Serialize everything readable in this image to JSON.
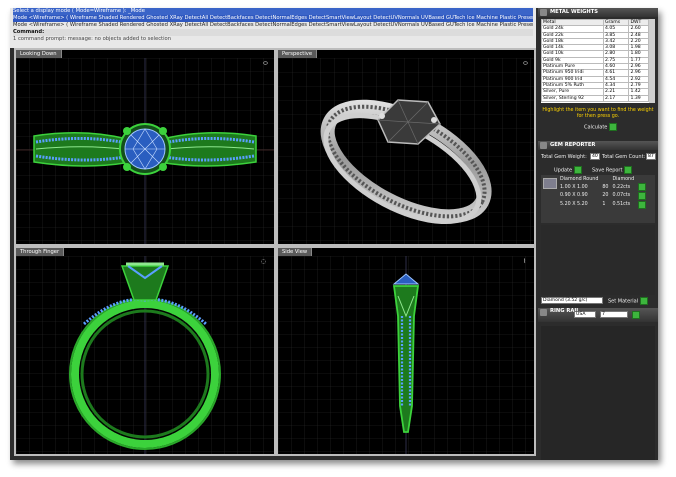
{
  "command": {
    "line1": "Select a display mode ( Mode=Wireframe ): _Mode",
    "line2": "Mode <Wireframe> ( Wireframe  Shaded  Rendered  Ghosted  XRay  DetectAll  DetectBackfaces  DetectNormalEdges  DetectSmartViewLayout  DetectUVNormals  UVBased  GUTech  Ice  Machine  Plastic  Presentation )",
    "line3": "Mode <Wireframe> ( Wireframe  Shaded  Rendered  Ghosted  XRay  DetectAll  DetectBackfaces  DetectNormalEdges  DetectSmartViewLayout  DetectUVNormals  UVBased  GUTech  Ice  Machine  Plastic  Presentation )",
    "prompt": "Command:",
    "history": "1 command prompt: message: no objects added to selection"
  },
  "viewports": {
    "top_left": "Looking Down",
    "top_right": "Perspective",
    "bottom_left": "Through Finger",
    "bottom_right": "Side View"
  },
  "metal_weights": {
    "title": "METAL WEIGHTS",
    "columns": [
      "Metal",
      "Grams",
      "DWT"
    ],
    "rows": [
      [
        "Gold 24k",
        "4.05",
        "2.60"
      ],
      [
        "Gold 22k",
        "3.85",
        "2.48"
      ],
      [
        "Gold 18k",
        "3.42",
        "2.20"
      ],
      [
        "Gold 14k",
        "3.08",
        "1.98"
      ],
      [
        "Gold 10k",
        "2.80",
        "1.80"
      ],
      [
        "Gold 9k",
        "2.75",
        "1.77"
      ],
      [
        "Platinum Pure",
        "4.60",
        "2.96"
      ],
      [
        "Platinum 950 Iridi",
        "4.61",
        "2.96"
      ],
      [
        "Platinum 900 Irid",
        "4.54",
        "2.92"
      ],
      [
        "Platinum 5% Ruth",
        "4.34",
        "2.79"
      ],
      [
        "Silver, Pure",
        "2.21",
        "1.42"
      ],
      [
        "Silver, Sterling 92",
        "2.17",
        "1.39"
      ]
    ],
    "help_text": "Highlight the item you want to find the weight for then press go.",
    "calculate_label": "Calculate"
  },
  "gem_reporter": {
    "title": "GEM REPORTER",
    "total_gem_weight_label": "Total Gem Weight:",
    "total_gem_weight": "40",
    "total_gem_count_label": "Total Gem Count:",
    "total_gem_count": "87",
    "update_label": "Update",
    "save_report_label": "Save Report",
    "header_shape": "Diamond Round",
    "header_material": "Diamond",
    "gems": [
      {
        "size": "1.00 X 1.00",
        "count": "80",
        "weight": "0.22cts"
      },
      {
        "size": "0.90 X 0.90",
        "count": "20",
        "weight": "0.07cts"
      },
      {
        "size": "5.20 X 5.20",
        "count": "1",
        "weight": "0.51cts"
      }
    ],
    "material_select": "Diamond (3.52 g/c)",
    "set_material_label": "Set Material"
  },
  "ring_size": {
    "title": "RING RAIL",
    "region": "USA",
    "size": "7"
  },
  "colors": {
    "wire_green": "#3cd23c",
    "wire_blue": "#5aa0ff",
    "grid": "#2a2a2a",
    "panel_accent": "#ffd400"
  }
}
